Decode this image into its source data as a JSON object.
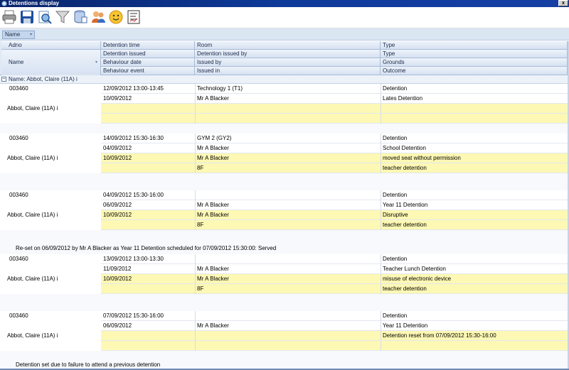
{
  "window": {
    "title": "Detentions display",
    "close_label": "x"
  },
  "toolbar": {
    "buttons": [
      {
        "icon": "printer-icon",
        "color": "#555555"
      },
      {
        "icon": "save-icon",
        "color": "#1f4f9e"
      },
      {
        "icon": "document-search-icon",
        "color": "#3a78c2"
      },
      {
        "icon": "filter-icon",
        "color": "#8a8a8a"
      },
      {
        "icon": "database-icon",
        "color": "#4b6fa8"
      },
      {
        "icon": "users-icon",
        "color": "#d86a2a"
      },
      {
        "icon": "smiley-icon",
        "color": "#f0a020"
      },
      {
        "icon": "report-icon",
        "color": "#333333"
      }
    ]
  },
  "groupby": {
    "chip": "Name"
  },
  "header": {
    "adno": "Adno",
    "name": "Name",
    "row1": [
      "Detention time",
      "Room",
      "Type"
    ],
    "row2": [
      "Detention issued",
      "Detention issued by",
      "Type"
    ],
    "row3": [
      "Behaviour date",
      "Issued by",
      "Grounds"
    ],
    "row4": [
      "Behaviour event",
      "Issued in",
      "Outcome"
    ]
  },
  "group": {
    "label": "Name:  Abbot, Claire (11A)   i"
  },
  "records": [
    {
      "adno": "003460",
      "name": "Abbot, Claire (11A)   i",
      "r1": [
        "12/09/2012 13:00-13:45",
        "Technology 1 (T1)",
        "Detention"
      ],
      "r2": [
        "10/09/2012",
        "Mr A Blacker",
        "Lates Detention"
      ],
      "r3": [
        "",
        "",
        ""
      ],
      "r4": [
        "",
        "",
        ""
      ],
      "note": ""
    },
    {
      "adno": "003460",
      "name": "Abbot, Claire (11A)   i",
      "r1": [
        "14/09/2012 15:30-16:30",
        "GYM 2 (GY2)",
        "Detention"
      ],
      "r2": [
        "04/09/2012",
        "Mr A Blacker",
        "School Detention"
      ],
      "r3": [
        "10/09/2012",
        "Mr A Blacker",
        "moved seat without permission"
      ],
      "r4": [
        "",
        "8F",
        "teacher detention"
      ],
      "note": ""
    },
    {
      "adno": "003460",
      "name": "Abbot, Claire (11A)   i",
      "r1": [
        "04/09/2012 15:30-16:00",
        "",
        "Detention"
      ],
      "r2": [
        "06/09/2012",
        "Mr A Blacker",
        "Year 11 Detention"
      ],
      "r3": [
        "10/09/2012",
        "Mr A Blacker",
        "Disruptive"
      ],
      "r4": [
        "",
        "8F",
        "teacher detention"
      ],
      "note": "Re-set on 06/09/2012 by  Mr A Blacker as  Year 11 Detention scheduled for 07/09/2012 15:30:00: Served"
    },
    {
      "adno": "003460",
      "name": "Abbot, Claire (11A)   i",
      "r1": [
        "13/09/2012 13:00-13:30",
        "",
        "Detention"
      ],
      "r2": [
        "11/09/2012",
        "Mr A Blacker",
        "Teacher Lunch Detention"
      ],
      "r3": [
        "10/09/2012",
        "Mr A Blacker",
        "misuse of electronic device"
      ],
      "r4": [
        "",
        "8F",
        "teacher detention"
      ],
      "note": ""
    },
    {
      "adno": "003460",
      "name": "Abbot, Claire (11A)   i",
      "r1": [
        "07/09/2012 15:30-16:00",
        "",
        "Detention"
      ],
      "r2": [
        "06/09/2012",
        "Mr A Blacker",
        "Year 11 Detention"
      ],
      "r3": [
        "",
        "",
        "Detention reset from 07/09/2012 15:30-16:00"
      ],
      "r4": [
        "",
        "",
        ""
      ],
      "note": "Detention set due to failure to attend a previous detention"
    }
  ]
}
